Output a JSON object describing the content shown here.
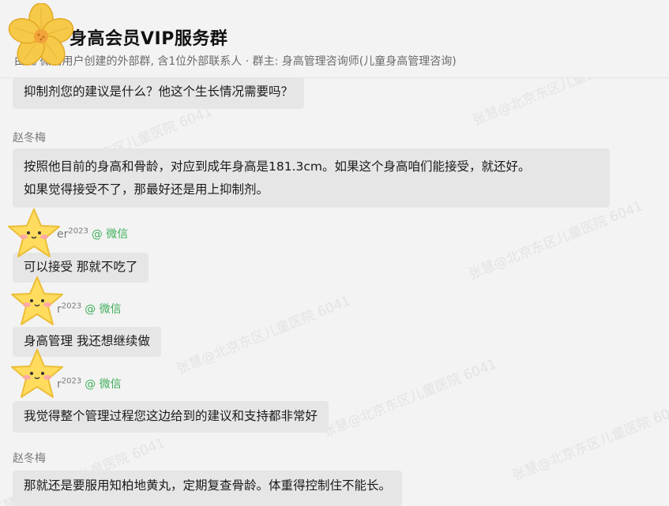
{
  "header": {
    "title": "身高会员VIP服务群",
    "subtitle_visible": "由此 微信用户创建的外部群, 含1位外部联系人 · 群主: 身高管理咨询师(儿童身高管理咨询)"
  },
  "watermark": {
    "text": "张慧@北京东区儿童医院 6041"
  },
  "messages": [
    {
      "sender": "",
      "text_lines": [
        "抑制剂您的建议是什么？他这个生长情况需要吗？"
      ]
    },
    {
      "sender": "赵冬梅",
      "text_lines": [
        "按照他目前的身高和骨龄，对应到成年身高是181.3cm。如果这个身高咱们能接受，就还好。",
        "如果觉得接受不了，那最好还是用上抑制剂。"
      ]
    },
    {
      "sender_visible": "er",
      "sender_sup": "2023",
      "sender_source": "@ 微信",
      "text_lines": [
        "可以接受 那就不吃了"
      ]
    },
    {
      "sender_visible": "r",
      "sender_sup": "2023",
      "sender_source": "@ 微信",
      "text_lines": [
        "身高管理 我还想继续做"
      ]
    },
    {
      "sender_visible": "r",
      "sender_sup": "2023",
      "sender_source": "@ 微信",
      "text_lines": [
        "我觉得整个管理过程您这边给到的建议和支持都非常好"
      ]
    },
    {
      "sender": "赵冬梅",
      "text_lines": [
        "那就还是要服用知柏地黄丸，定期复查骨龄。体重得控制住不能长。"
      ]
    }
  ],
  "colors": {
    "background": "#f3f3f3",
    "bubble": "#e6e6e6",
    "wechat_green": "#3fae5a",
    "flower": "#f5c542",
    "star": "#ffd95a"
  },
  "icons": {
    "flower_sticker": "flower-sticker-icon",
    "star_sticker": "star-face-sticker-icon"
  }
}
